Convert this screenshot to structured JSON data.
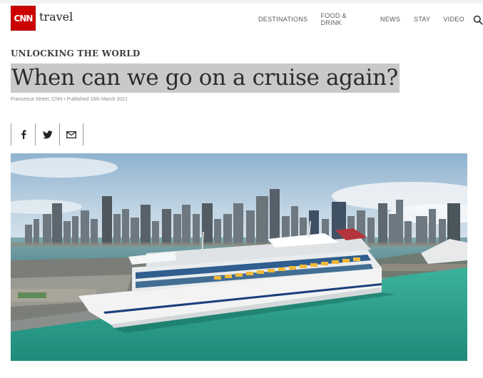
{
  "header": {
    "logo_text": "CNN",
    "section_name": "travel",
    "nav": [
      {
        "label": "DESTINATIONS"
      },
      {
        "label": "FOOD & DRINK"
      },
      {
        "label": "NEWS"
      },
      {
        "label": "STAY"
      },
      {
        "label": "VIDEO"
      }
    ],
    "search_icon": "search-icon"
  },
  "article": {
    "kicker": "UNLOCKING THE WORLD",
    "headline": "When can we go on a cruise again?",
    "byline": "Francesca Street, CNN • Published 15th March 2021",
    "share": [
      {
        "icon": "facebook-icon"
      },
      {
        "icon": "twitter-icon"
      },
      {
        "icon": "email-icon"
      }
    ],
    "hero_image": "cruise-ship-in-port-with-city-skyline"
  },
  "colors": {
    "brand_red": "#cc0000",
    "headline_highlight": "#c9c9c9",
    "water": "#2fa38f",
    "ship_hull": "#f2f2f2"
  }
}
